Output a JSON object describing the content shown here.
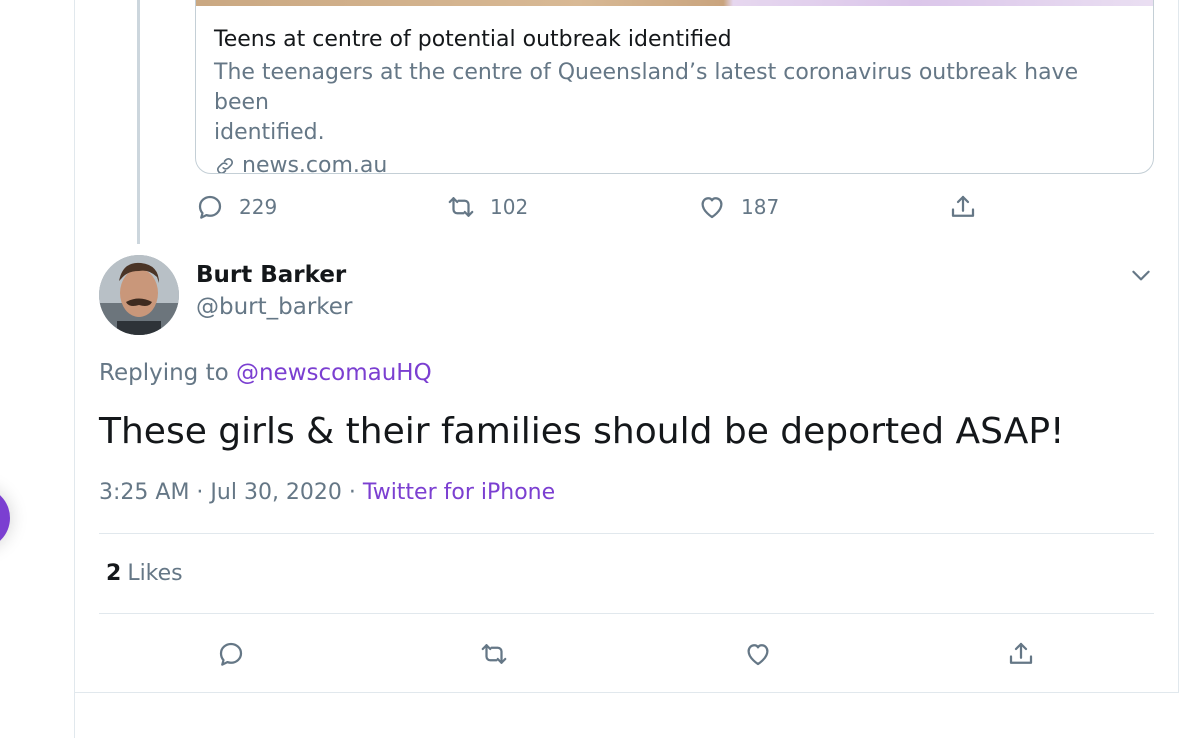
{
  "quoted_card": {
    "title": "Teens at centre of potential outbreak identified",
    "description_line1": "The teenagers at the centre of Queensland’s latest coronavirus outbreak have been",
    "description_line2": "identified.",
    "domain": "news.com.au"
  },
  "parent_actions": {
    "replies": "229",
    "retweets": "102",
    "likes": "187"
  },
  "reply_tweet": {
    "display_name": "Burt Barker",
    "handle": "@burt_barker",
    "replying_prefix": "Replying to ",
    "replying_to": "@newscomauHQ",
    "text": "These girls & their families should be deported ASAP!",
    "timestamp": "3:25 AM · Jul 30, 2020 · ",
    "source": "Twitter for iPhone",
    "likes_count": "2",
    "likes_label": "Likes"
  },
  "colors": {
    "accent": "#7b3fd1",
    "muted": "#657786",
    "border": "#e1e8ed"
  },
  "icons": [
    "link-icon",
    "reply-icon",
    "retweet-icon",
    "like-icon",
    "share-icon",
    "chevron-down-icon"
  ]
}
